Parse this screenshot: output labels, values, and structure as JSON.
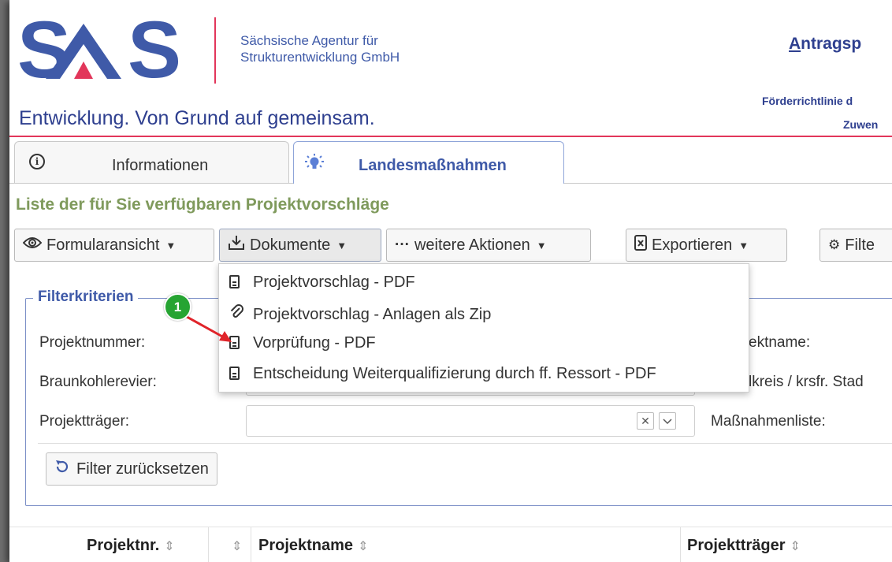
{
  "header": {
    "logo_text": "SAS",
    "agency_line1": "Sächsische Agentur für",
    "agency_line2": "Strukturentwicklung GmbH",
    "tagline": "Entwicklung. Von Grund auf gemeinsam.",
    "portal_title_first": "A",
    "portal_title_rest": "ntragsp",
    "subtitle1": "Förderrichtlinie d",
    "subtitle2": "Zuwen"
  },
  "tabs": [
    {
      "label": "Informationen",
      "icon": "info-circle-icon",
      "active": false
    },
    {
      "label": "Landesmaßnahmen",
      "icon": "lightbulb-icon",
      "active": true
    }
  ],
  "list_title": "Liste der für Sie verfügbaren Projektvorschläge",
  "toolbar": {
    "form_view": "Formularansicht",
    "documents": "Dokumente",
    "more_actions": "weitere Aktionen",
    "export": "Exportieren",
    "filter": "Filte"
  },
  "dropdown": {
    "items": [
      {
        "label": "Projektvorschlag - PDF",
        "icon": "document-icon"
      },
      {
        "label": "Projektvorschlag - Anlagen als Zip",
        "icon": "paperclip-icon"
      },
      {
        "label": "Vorprüfung - PDF",
        "icon": "document-icon"
      },
      {
        "label": "Entscheidung Weiterqualifizierung durch ff. Ressort - PDF",
        "icon": "document-icon"
      }
    ]
  },
  "filter": {
    "legend": "Filterkriterien",
    "project_number": "Projektnummer:",
    "project_name": "ektname:",
    "lignite_area": "Braunkohlerevier:",
    "district": "lkreis / krsfr. Stad",
    "sponsor": "Projektträger:",
    "measures_list": "Maßnahmenliste:",
    "clear_symbol": "✕",
    "reset_button": "Filter zurücksetzen"
  },
  "table": {
    "headers": [
      "Projektnr.",
      "Projektname",
      "Projektträger"
    ]
  },
  "annotation": {
    "badge": "1"
  },
  "colors": {
    "brand_blue": "#3f5aa8",
    "brand_red": "#e2365a",
    "title_green": "#7f9a5c",
    "badge_green": "#26a432",
    "arrow_red": "#e0242a"
  }
}
